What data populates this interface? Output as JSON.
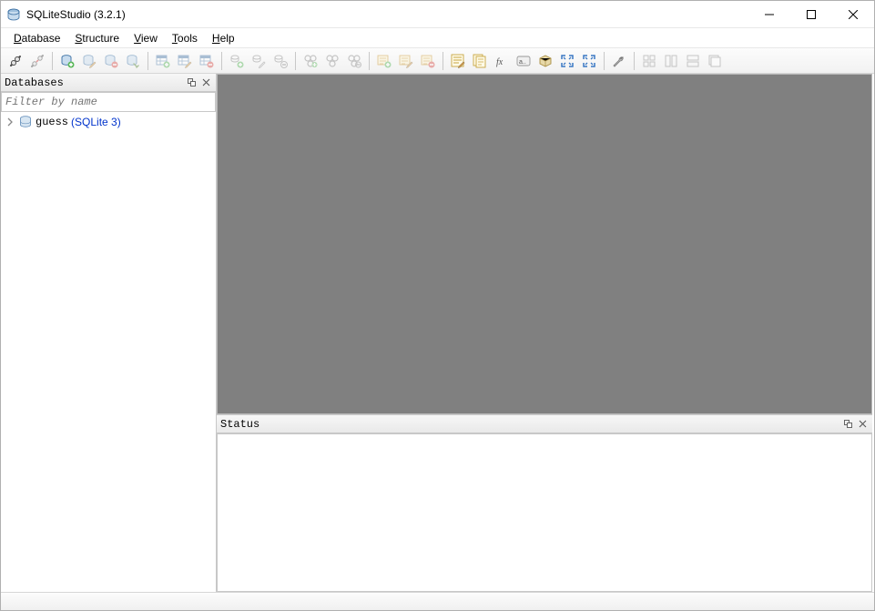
{
  "window": {
    "title": "SQLiteStudio (3.2.1)"
  },
  "menu": {
    "items": [
      {
        "label": "Database",
        "ul": "D"
      },
      {
        "label": "Structure",
        "ul": "S"
      },
      {
        "label": "View",
        "ul": "V"
      },
      {
        "label": "Tools",
        "ul": "T"
      },
      {
        "label": "Help",
        "ul": "H"
      }
    ]
  },
  "toolbar": {
    "groups": [
      [
        "connect",
        "disconnect"
      ],
      [
        "db-add",
        "db-edit",
        "db-delete",
        "db-link"
      ],
      [
        "table-create",
        "table-edit",
        "table-delete"
      ],
      [
        "index-create",
        "trigger-create",
        "view-create"
      ],
      [
        "copy-snippet",
        "copy-all",
        "copy-styled"
      ],
      [
        "form-add",
        "form-edit",
        "form-delete"
      ],
      [
        "sql-editor",
        "sql-history",
        "fx-function",
        "keyword-a",
        "bundle",
        "zoom-fit",
        "zoom-full"
      ],
      [
        "wrench"
      ],
      [
        "layout-grid",
        "layout-cols",
        "layout-rows",
        "layout-stack"
      ]
    ]
  },
  "sidepanel": {
    "title": "Databases",
    "filter_placeholder": "Filter by name",
    "tree": {
      "name": "guess",
      "meta": "(SQLite 3)"
    }
  },
  "status": {
    "title": "Status"
  }
}
